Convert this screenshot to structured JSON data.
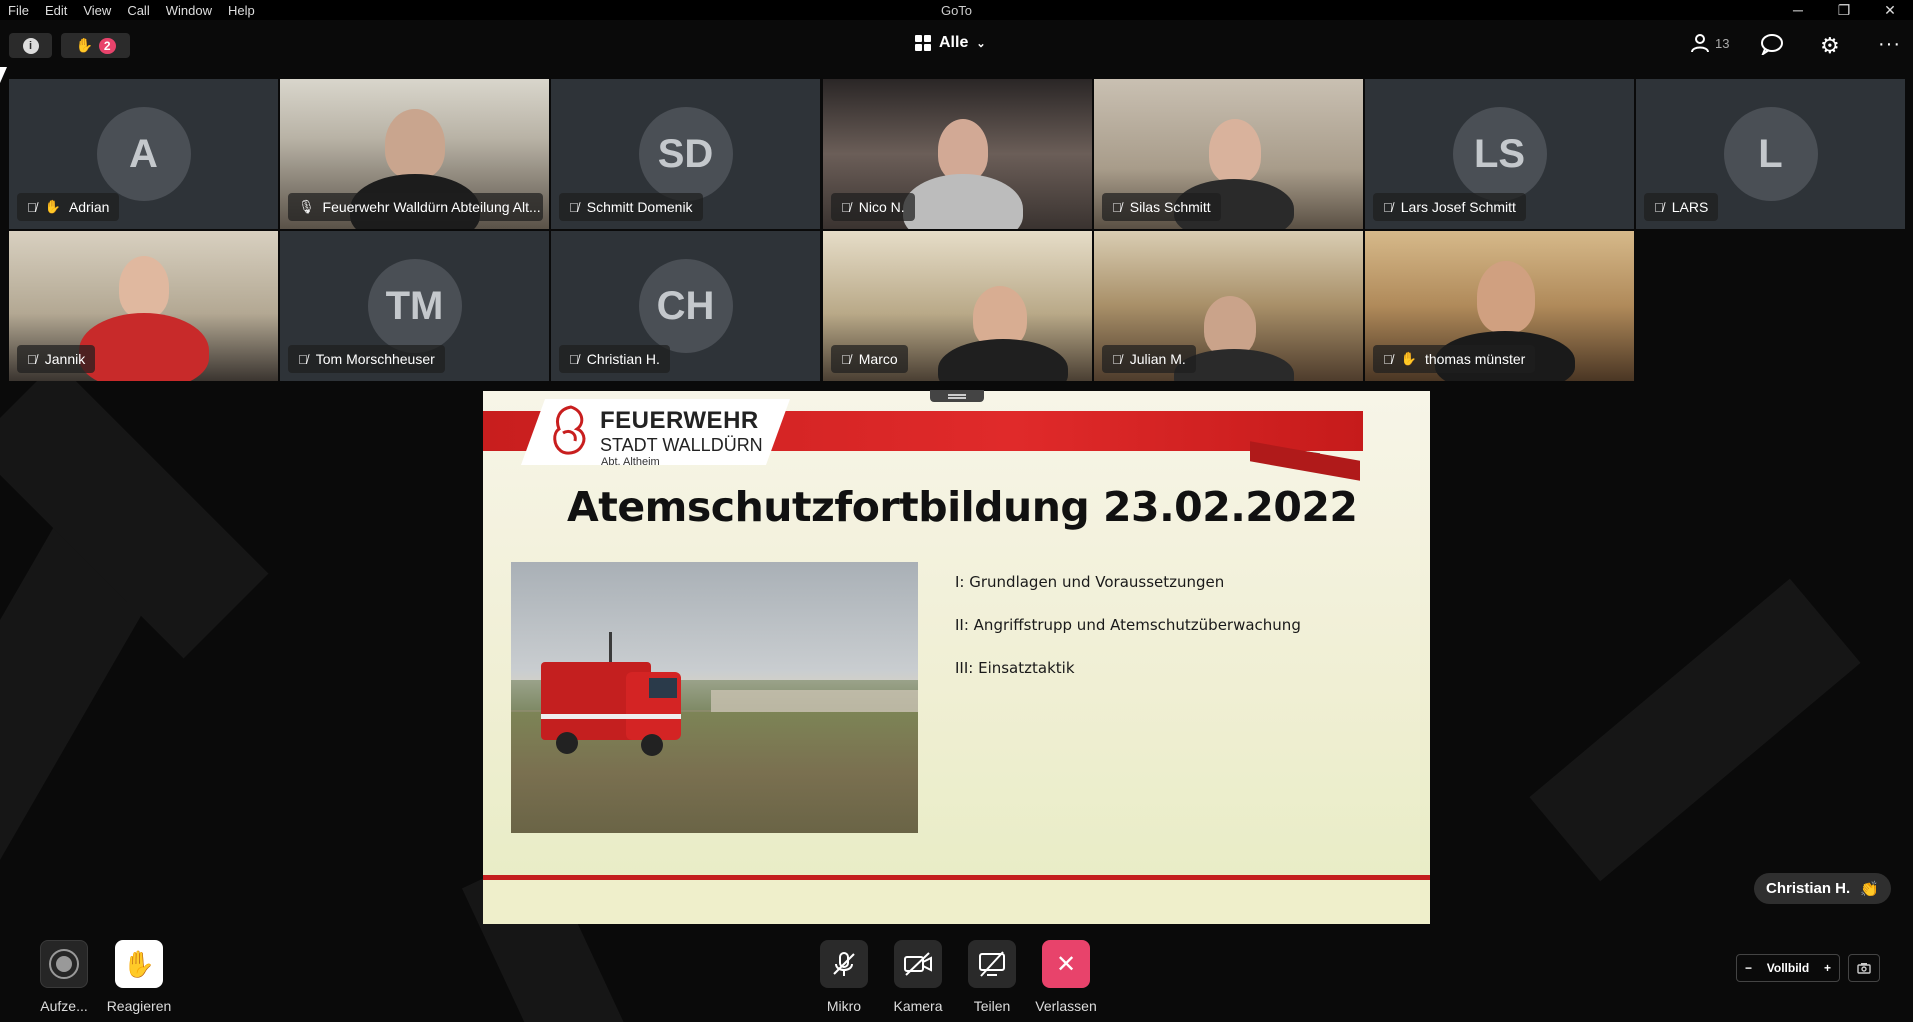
{
  "menubar": {
    "items": [
      "File",
      "Edit",
      "View",
      "Call",
      "Window",
      "Help"
    ],
    "app_title": "GoTo"
  },
  "toolbar": {
    "raised_hands_count": "2",
    "view_label": "Alle",
    "participants_count": "13"
  },
  "participants": [
    {
      "name": "Adrian",
      "initials": "A",
      "muted": true,
      "hand_raised": true,
      "video": false
    },
    {
      "name": "Feuerwehr Walldürn Abteilung Alt...",
      "initials": "",
      "muted": false,
      "hand_raised": false,
      "video": true
    },
    {
      "name": "Schmitt Domenik",
      "initials": "SD",
      "muted": true,
      "hand_raised": false,
      "video": false
    },
    {
      "name": "Nico N.",
      "initials": "",
      "muted": true,
      "hand_raised": false,
      "video": true
    },
    {
      "name": "Silas Schmitt",
      "initials": "",
      "muted": true,
      "hand_raised": false,
      "video": true
    },
    {
      "name": "Lars Josef Schmitt",
      "initials": "LS",
      "muted": true,
      "hand_raised": false,
      "video": false
    },
    {
      "name": "LARS",
      "initials": "L",
      "muted": true,
      "hand_raised": false,
      "video": false
    },
    {
      "name": "Jannik",
      "initials": "",
      "muted": true,
      "hand_raised": false,
      "video": true
    },
    {
      "name": "Tom Morschheuser",
      "initials": "TM",
      "muted": true,
      "hand_raised": false,
      "video": false
    },
    {
      "name": "Christian H.",
      "initials": "CH",
      "muted": true,
      "hand_raised": false,
      "video": false
    },
    {
      "name": "Marco",
      "initials": "",
      "muted": true,
      "hand_raised": false,
      "video": true
    },
    {
      "name": "Julian M.",
      "initials": "",
      "muted": true,
      "hand_raised": false,
      "video": true
    },
    {
      "name": "thomas münster",
      "initials": "",
      "muted": true,
      "hand_raised": true,
      "video": true
    }
  ],
  "slide": {
    "org_title": "FEUERWEHR",
    "org_subtitle": "STADT WALLDÜRN",
    "org_department": "Abt. Altheim",
    "title": "Atemschutzfortbildung 23.02.2022",
    "items": [
      "I: Grundlagen und Voraussetzungen",
      "II: Angriffstrupp und Atemschutzüberwachung",
      "III: Einsatztaktik"
    ]
  },
  "reaction_toast": {
    "name": "Christian H.",
    "emoji": "👏"
  },
  "controls": {
    "record_label": "Aufze...",
    "react_label": "Reagieren",
    "mic_label": "Mikro",
    "camera_label": "Kamera",
    "share_label": "Teilen",
    "leave_label": "Verlassen",
    "fullscreen_label": "Vollbild"
  },
  "colors": {
    "leave_button": "#e8436b",
    "slide_red": "#c81e1e",
    "tile_background": "#2e3338"
  }
}
